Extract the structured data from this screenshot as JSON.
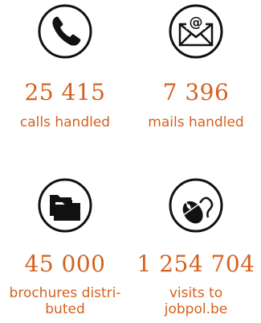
{
  "stats": [
    {
      "icon": "phone-icon",
      "number": "25 415",
      "label_lines": [
        "calls handled"
      ]
    },
    {
      "icon": "mail-icon",
      "number": "7 396",
      "label_lines": [
        "mails handled"
      ]
    },
    {
      "icon": "folder-icon",
      "number": "45 000",
      "label_lines": [
        "brochures distri-",
        "buted"
      ]
    },
    {
      "icon": "mouse-icon",
      "number": "1 254 704",
      "label_lines": [
        "visits to",
        "jobpol.be"
      ]
    }
  ],
  "colors": {
    "accent": "#d4611e",
    "icon": "#111111"
  }
}
